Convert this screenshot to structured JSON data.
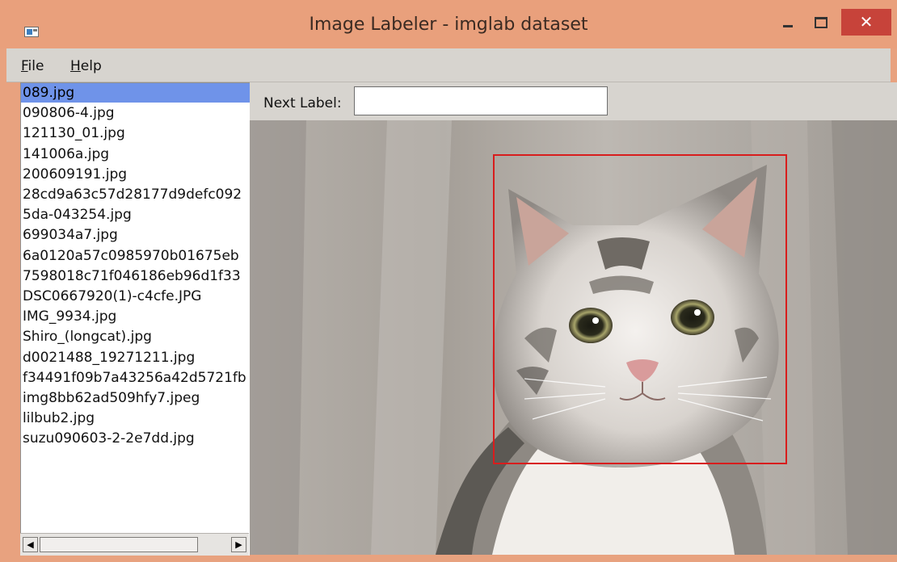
{
  "window": {
    "title": "Image Labeler - imglab dataset",
    "close_glyph": "✕"
  },
  "menu": {
    "file_mnemonic": "F",
    "file_rest": "ile",
    "help_mnemonic": "H",
    "help_rest": "elp"
  },
  "file_list": [
    "089.jpg",
    "090806-4.jpg",
    "121130_01.jpg",
    "141006a.jpg",
    "200609191.jpg",
    "28cd9a63c57d28177d9defc092",
    "5da-043254.jpg",
    "699034a7.jpg",
    "6a0120a57c0985970b01675eb",
    "7598018c71f046186eb96d1f33",
    "DSC0667920(1)-c4cfe.JPG",
    "IMG_9934.jpg",
    "Shiro_(longcat).jpg",
    "d0021488_19271211.jpg",
    "f34491f09b7a43256a42d5721fb",
    "img8bb62ad509hfy7.jpeg",
    "lilbub2.jpg",
    "suzu090603-2-2e7dd.jpg"
  ],
  "selected_index": 0,
  "label_bar": {
    "label": "Next Label:",
    "value": ""
  },
  "scroll": {
    "left_glyph": "◀",
    "right_glyph": "▶"
  },
  "colors": {
    "title_bar": "#e9a07c",
    "selection": "#6f93e9",
    "bbox": "#d81d1d",
    "close_button": "#c7433a"
  },
  "icons": {
    "app": "app-window-icon",
    "minimize": "minimize-icon",
    "maximize": "maximize-icon",
    "close": "close-icon",
    "scroll_left": "arrow-left-icon",
    "scroll_right": "arrow-right-icon"
  }
}
